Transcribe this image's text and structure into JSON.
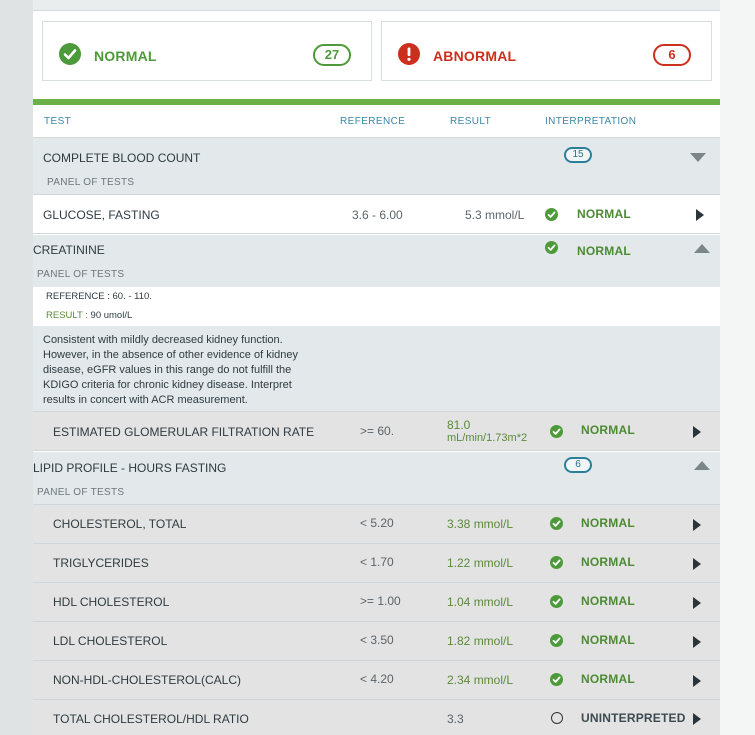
{
  "summary": {
    "normal": {
      "label": "NORMAL",
      "count": "27"
    },
    "abnormal": {
      "label": "ABNORMAL",
      "count": "6"
    }
  },
  "columns": {
    "test": "TEST",
    "reference": "REFERENCE",
    "result": "RESULT",
    "interpretation": "INTERPRETATION"
  },
  "cbc": {
    "name": "COMPLETE BLOOD COUNT",
    "sub": "PANEL OF TESTS",
    "count": "15"
  },
  "glucose": {
    "name": "GLUCOSE, FASTING",
    "reference": "3.6 - 6.00",
    "result": "5.3 mmol/L",
    "interpretation": "NORMAL"
  },
  "creatinine": {
    "name": "CREATININE",
    "sub": "PANEL OF TESTS",
    "interpretation": "NORMAL",
    "ref_label": "REFERENCE : ",
    "ref_value": "60. - 110.",
    "res_label": "RESULT : ",
    "res_value": "90 umol/L",
    "note": "Consistent with mildly decreased kidney function. However, in the absence of other evidence of kidney disease, eGFR values in this range do not fulfill the KDIGO criteria for chronic kidney disease. Interpret results in concert with ACR measurement."
  },
  "egfr": {
    "name": "ESTIMATED GLOMERULAR FILTRATION RATE",
    "reference": ">= 60.",
    "result_line1": "81.0",
    "result_line2": "mL/min/1.73m*2",
    "interpretation": "NORMAL"
  },
  "lipid": {
    "name": "LIPID PROFILE - HOURS FASTING",
    "sub": "PANEL OF TESTS",
    "count": "6"
  },
  "lipid_rows": [
    {
      "name": "CHOLESTEROL, TOTAL",
      "reference": "< 5.20",
      "result": "3.38 mmol/L",
      "interpretation": "NORMAL"
    },
    {
      "name": "TRIGLYCERIDES",
      "reference": "< 1.70",
      "result": "1.22 mmol/L",
      "interpretation": "NORMAL"
    },
    {
      "name": "HDL CHOLESTEROL",
      "reference": ">= 1.00",
      "result": "1.04 mmol/L",
      "interpretation": "NORMAL"
    },
    {
      "name": "LDL CHOLESTEROL",
      "reference": "< 3.50",
      "result": "1.82 mmol/L",
      "interpretation": "NORMAL"
    },
    {
      "name": "NON-HDL-CHOLESTEROL(CALC)",
      "reference": "< 4.20",
      "result": "2.34 mmol/L",
      "interpretation": "NORMAL"
    },
    {
      "name": "TOTAL CHOLESTEROL/HDL RATIO",
      "reference": "",
      "result": "3.3",
      "interpretation": "UNINTERPRETED"
    }
  ],
  "colors": {
    "normal": "#4d9a3a",
    "abnormal": "#cc2f1d",
    "accent_bar": "#6cb048",
    "count_badge": "#2c7f9b"
  },
  "icons": {
    "normal": "check-circle-icon",
    "abnormal": "exclamation-circle-icon",
    "expand": "caret-down-icon",
    "collapse": "caret-up-icon",
    "open": "chevron-right-icon",
    "uninterpreted": "empty-circle-icon"
  }
}
